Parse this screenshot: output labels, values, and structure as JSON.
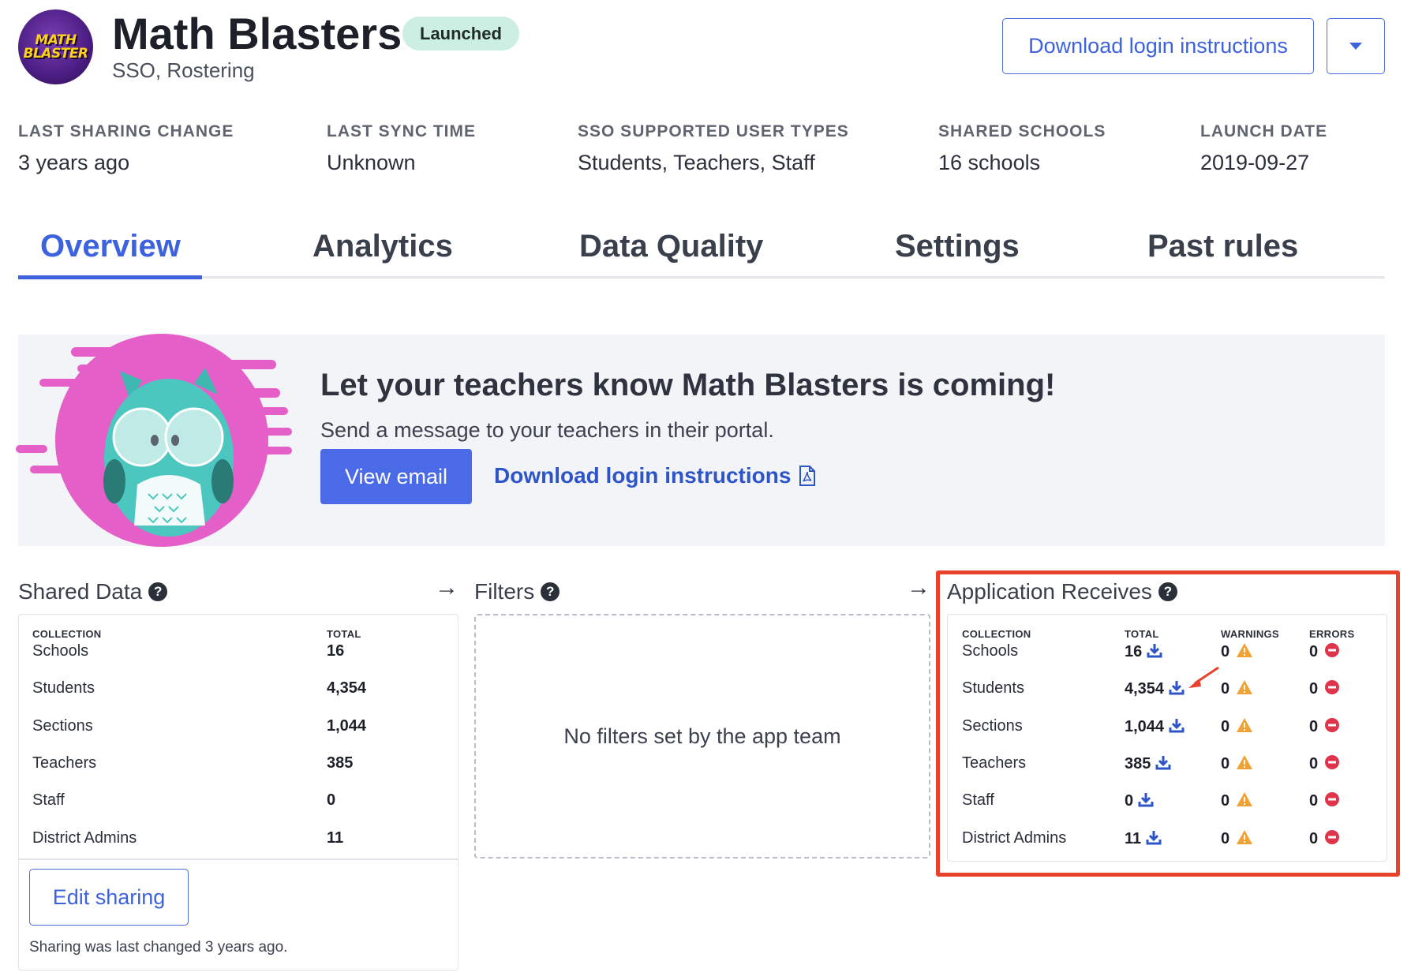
{
  "header": {
    "logo_text": "MATH\nBLASTER",
    "title": "Math Blasters",
    "subtitle": "SSO, Rostering",
    "status_badge": "Launched",
    "download_button": "Download login instructions",
    "dropdown_icon": "chevron-down-icon"
  },
  "meta": [
    {
      "label": "LAST SHARING CHANGE",
      "value": "3 years ago"
    },
    {
      "label": "LAST SYNC TIME",
      "value": "Unknown"
    },
    {
      "label": "SSO SUPPORTED USER TYPES",
      "value": "Students, Teachers, Staff"
    },
    {
      "label": "SHARED SCHOOLS",
      "value": "16 schools"
    },
    {
      "label": "LAUNCH DATE",
      "value": "2019-09-27"
    }
  ],
  "tabs": [
    {
      "label": "Overview",
      "active": true
    },
    {
      "label": "Analytics",
      "active": false
    },
    {
      "label": "Data Quality",
      "active": false
    },
    {
      "label": "Settings",
      "active": false
    },
    {
      "label": "Past rules",
      "active": false
    }
  ],
  "banner": {
    "title": "Let your teachers know Math Blasters is coming!",
    "text": "Send a message to your teachers in their portal.",
    "view_email_button": "View email",
    "download_link": "Download login instructions",
    "download_link_icon": "pdf-icon",
    "illustration": "owl-illustration"
  },
  "shared_data": {
    "title": "Shared Data",
    "col_collection": "COLLECTION",
    "col_total": "TOTAL",
    "rows": [
      {
        "collection": "Schools",
        "total": "16"
      },
      {
        "collection": "Students",
        "total": "4,354"
      },
      {
        "collection": "Sections",
        "total": "1,044"
      },
      {
        "collection": "Teachers",
        "total": "385"
      },
      {
        "collection": "Staff",
        "total": "0"
      },
      {
        "collection": "District Admins",
        "total": "11"
      }
    ],
    "edit_button": "Edit sharing",
    "note": "Sharing was last changed 3 years ago."
  },
  "filters": {
    "title": "Filters",
    "empty_text": "No filters set by the app team"
  },
  "application_receives": {
    "title": "Application Receives",
    "col_collection": "COLLECTION",
    "col_total": "TOTAL",
    "col_warnings": "WARNINGS",
    "col_errors": "ERRORS",
    "rows": [
      {
        "collection": "Schools",
        "total": "16",
        "warnings": "0",
        "errors": "0"
      },
      {
        "collection": "Students",
        "total": "4,354",
        "warnings": "0",
        "errors": "0"
      },
      {
        "collection": "Sections",
        "total": "1,044",
        "warnings": "0",
        "errors": "0"
      },
      {
        "collection": "Teachers",
        "total": "385",
        "warnings": "0",
        "errors": "0"
      },
      {
        "collection": "Staff",
        "total": "0",
        "warnings": "0",
        "errors": "0"
      },
      {
        "collection": "District Admins",
        "total": "11",
        "warnings": "0",
        "errors": "0"
      }
    ]
  },
  "colors": {
    "accent": "#3d62de",
    "badge_bg": "#cdeee3",
    "highlight": "#e8412c",
    "warning": "#f0a235",
    "error": "#e0334c"
  }
}
